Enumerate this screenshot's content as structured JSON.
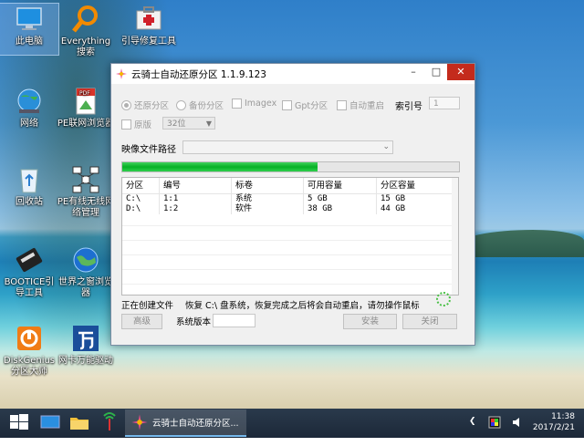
{
  "desktop": {
    "icons": [
      {
        "label": "此电脑"
      },
      {
        "label": "Everything搜索"
      },
      {
        "label": "引导修复工具"
      },
      {
        "label": "网络"
      },
      {
        "label": "PE联网浏览器"
      },
      {
        "label": "回收站"
      },
      {
        "label": "PE有线无线网络管理"
      },
      {
        "label": "BOOTICE引导工具"
      },
      {
        "label": "世界之窗浏览器"
      },
      {
        "label": "DiskGenius分区大师"
      },
      {
        "label": "网卡万能驱动"
      }
    ]
  },
  "window": {
    "title": "云骑士自动还原分区 1.1.9.123",
    "options": {
      "restore": "还原分区",
      "backup": "备份分区",
      "imagex": "Imagex",
      "gpt": "Gpt分区",
      "auto_restart": "自动重启",
      "index_label": "索引号",
      "index_value": "1",
      "original": "原版",
      "bits": "32位"
    },
    "image_path_label": "映像文件路径",
    "image_path_value": "",
    "progress": 0.58,
    "table": {
      "headers": [
        "分区",
        "编号",
        "标卷",
        "可用容量",
        "分区容量"
      ],
      "rows": [
        [
          "C:\\",
          "1:1",
          "系统",
          "5 GB",
          "15 GB"
        ],
        [
          "D:\\",
          "1:2",
          "软件",
          "38 GB",
          "44 GB"
        ]
      ]
    },
    "status_left": "正在创建文件",
    "status_right": "恢复 C:\\ 盘系统，恢复完成之后将会自动重启，请勿操作鼠标",
    "buttons": {
      "advanced": "高级",
      "system_version": "系统版本",
      "install": "安装",
      "close": "关闭"
    }
  },
  "taskbar": {
    "task_label": "云骑士自动还原分区...",
    "time": "11:38",
    "date": "2017/2/21"
  },
  "colors": {
    "progress_green": "#06b025",
    "close_red": "#c42b1c",
    "taskbar": "#1c2838"
  }
}
